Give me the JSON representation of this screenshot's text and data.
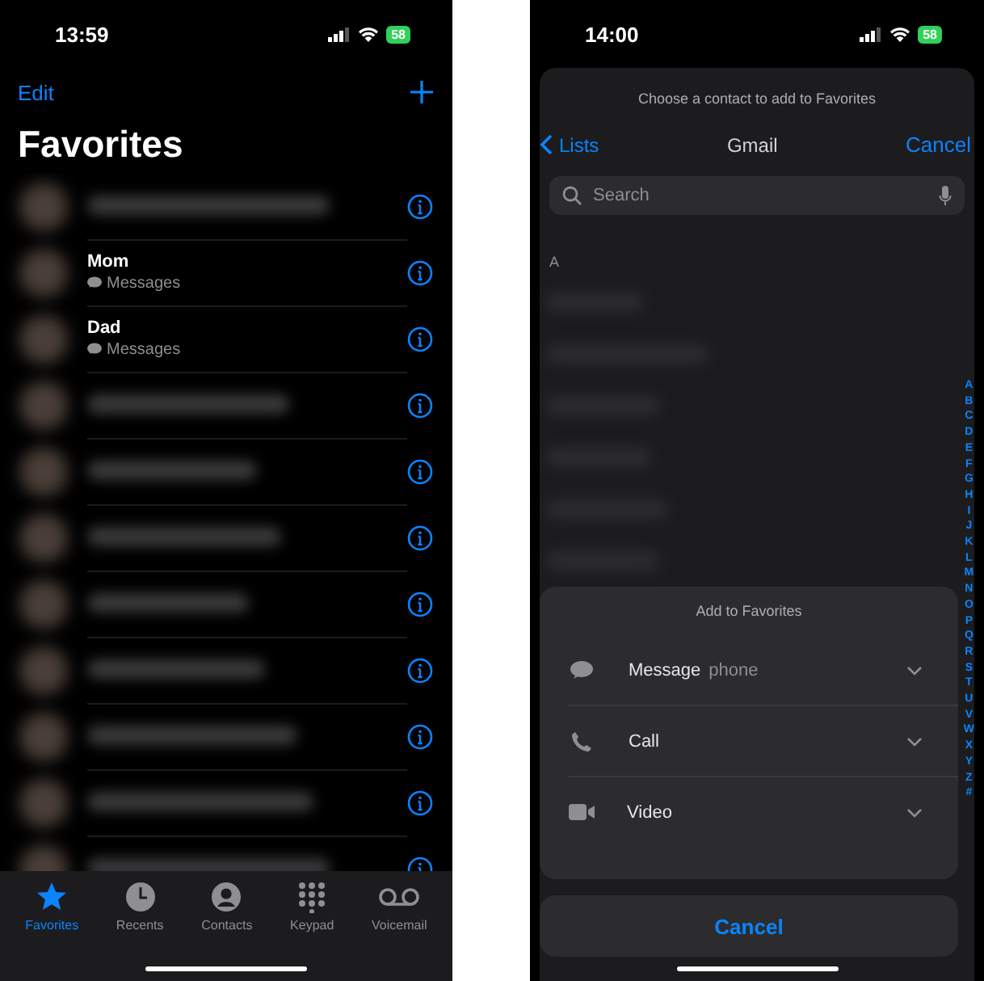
{
  "favorites_screen": {
    "status_bar": {
      "time": "13:59",
      "battery": "58"
    },
    "edit": "Edit",
    "title": "Favorites",
    "rows": [
      {
        "kind": "blurred"
      },
      {
        "kind": "contact",
        "name": "Mom",
        "detail": "Messages"
      },
      {
        "kind": "contact",
        "name": "Dad",
        "detail": "Messages"
      },
      {
        "kind": "blurred"
      },
      {
        "kind": "blurred"
      },
      {
        "kind": "blurred"
      },
      {
        "kind": "blurred"
      },
      {
        "kind": "blurred"
      },
      {
        "kind": "blurred"
      },
      {
        "kind": "blurred"
      },
      {
        "kind": "blurred"
      }
    ],
    "tabs": [
      {
        "label": "Favorites",
        "selected": true
      },
      {
        "label": "Recents",
        "selected": false
      },
      {
        "label": "Contacts",
        "selected": false
      },
      {
        "label": "Keypad",
        "selected": false
      },
      {
        "label": "Voicemail",
        "selected": false
      }
    ]
  },
  "picker_screen": {
    "status_bar": {
      "time": "14:00",
      "battery": "58"
    },
    "prompt": "Choose a contact to add to Favorites",
    "back": "Lists",
    "title": "Gmail",
    "cancel": "Cancel",
    "search": {
      "placeholder": "Search"
    },
    "section": "A",
    "index": [
      "A",
      "B",
      "C",
      "D",
      "E",
      "F",
      "G",
      "H",
      "I",
      "J",
      "K",
      "L",
      "M",
      "N",
      "O",
      "P",
      "Q",
      "R",
      "S",
      "T",
      "U",
      "V",
      "W",
      "X",
      "Y",
      "Z",
      "#"
    ],
    "sheet": {
      "title": "Add to Favorites",
      "options": [
        {
          "label": "Message",
          "detail": "phone"
        },
        {
          "label": "Call"
        },
        {
          "label": "Video"
        }
      ],
      "cancel": "Cancel"
    }
  }
}
